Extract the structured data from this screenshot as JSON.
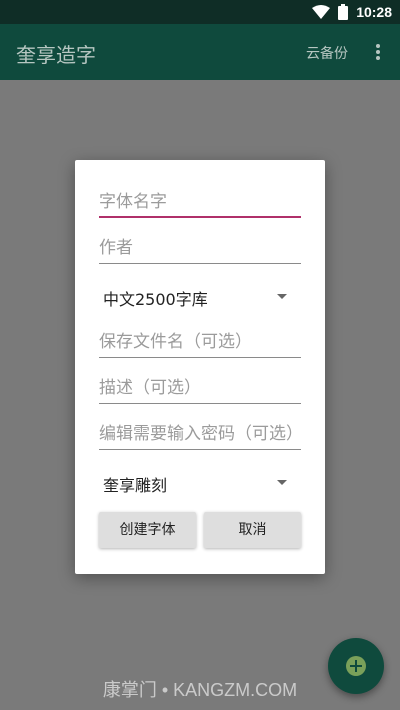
{
  "status_bar": {
    "time": "10:28",
    "icons": [
      "wifi-icon",
      "battery-icon"
    ]
  },
  "app_bar": {
    "title": "奎享造字",
    "action_label": "云备份",
    "overflow_icon": "more-vert-icon"
  },
  "dialog": {
    "fields": [
      {
        "name": "font-name-field",
        "placeholder": "字体名字",
        "focused": true
      },
      {
        "name": "author-field",
        "placeholder": "作者",
        "focused": false
      }
    ],
    "charset_select": {
      "value": "中文2500字库"
    },
    "fields2": [
      {
        "name": "filename-field",
        "placeholder": "保存文件名（可选）"
      },
      {
        "name": "description-field",
        "placeholder": "描述（可选）"
      },
      {
        "name": "password-field",
        "placeholder": "编辑需要输入密码（可选）"
      }
    ],
    "style_select": {
      "value": "奎享雕刻"
    },
    "buttons": {
      "create": "创建字体",
      "cancel": "取消"
    }
  },
  "fab": {
    "icon": "add-icon"
  },
  "watermark": "康掌门 • KANGZM.COM",
  "colors": {
    "app_bar": "#0f4a3d",
    "status_bar": "#0f2d26",
    "accent": "#b0306a",
    "scrim": "#7a7a7a"
  }
}
